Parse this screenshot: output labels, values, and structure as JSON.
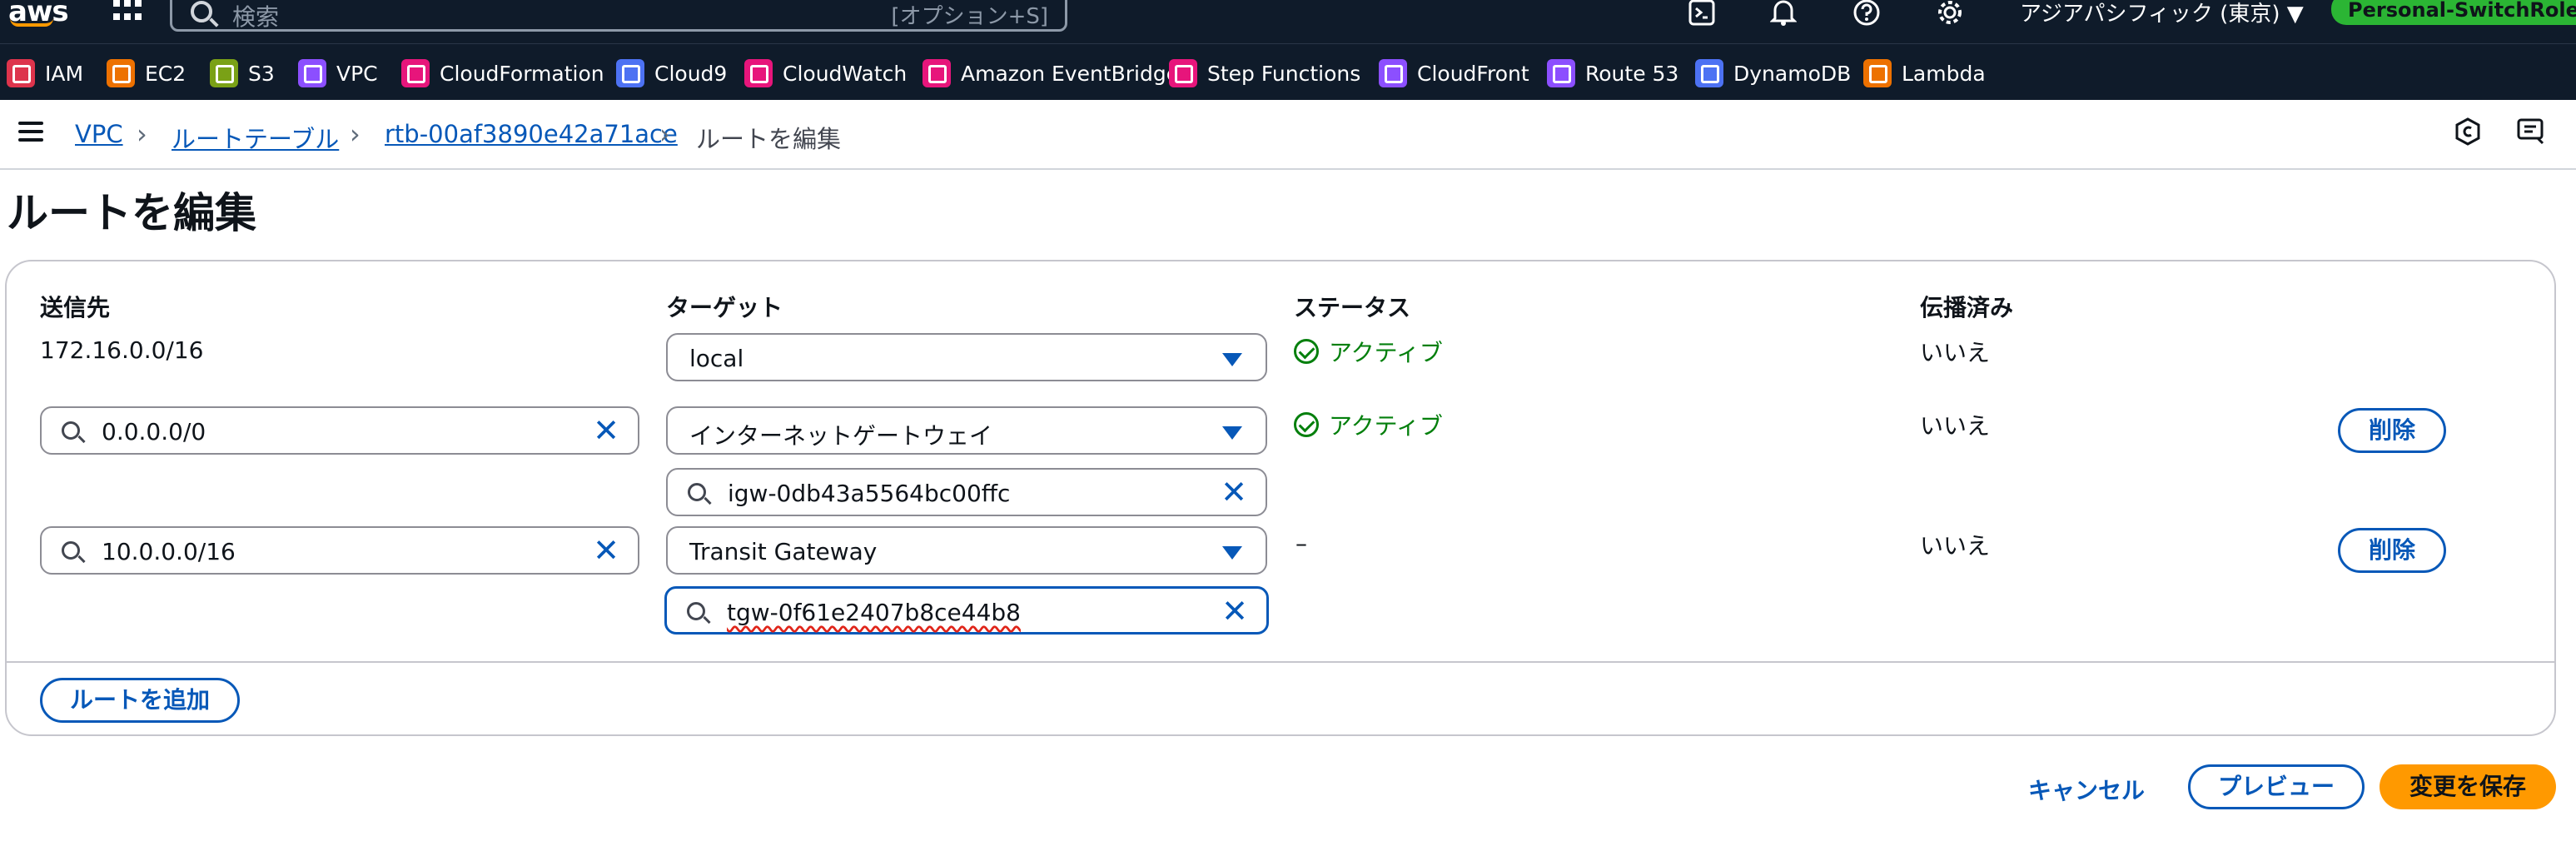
{
  "nav": {
    "logo": "aws",
    "search_placeholder": "検索",
    "search_shortcut": "[オプション+S]",
    "region": "アジアパシフィック (東京) ▼",
    "role": "Personal-SwitchRole ▼",
    "icons": [
      "services-grid-icon",
      "cloudshell-icon",
      "bell-icon",
      "help-icon",
      "gear-icon"
    ]
  },
  "favorites": [
    {
      "label": "IAM",
      "color": "#dd344c"
    },
    {
      "label": "EC2",
      "color": "#ed7100"
    },
    {
      "label": "S3",
      "color": "#7aa116"
    },
    {
      "label": "VPC",
      "color": "#8c4fff"
    },
    {
      "label": "CloudFormation",
      "color": "#e7157b"
    },
    {
      "label": "Cloud9",
      "color": "#4d72f3"
    },
    {
      "label": "CloudWatch",
      "color": "#e7157b"
    },
    {
      "label": "Amazon EventBridge",
      "color": "#e7157b"
    },
    {
      "label": "Step Functions",
      "color": "#e7157b"
    },
    {
      "label": "CloudFront",
      "color": "#8c4fff"
    },
    {
      "label": "Route 53",
      "color": "#8c4fff"
    },
    {
      "label": "DynamoDB",
      "color": "#4d72f3"
    },
    {
      "label": "Lambda",
      "color": "#ed7100"
    }
  ],
  "breadcrumb": {
    "items": [
      "VPC",
      "ルートテーブル",
      "rtb-00af3890e42a71ace"
    ],
    "current": "ルートを編集"
  },
  "page": {
    "title": "ルートを編集"
  },
  "table": {
    "columns": {
      "destination": "送信先",
      "target": "ターゲット",
      "status": "ステータス",
      "propagated": "伝播済み"
    },
    "rows": [
      {
        "destination": "172.16.0.0/16",
        "target": "local",
        "target_id": "",
        "status": "アクティブ",
        "propagated": "いいえ",
        "delete": ""
      },
      {
        "destination": "0.0.0.0/0",
        "target": "インターネットゲートウェイ",
        "target_id": "igw-0db43a5564bc00ffc",
        "status": "アクティブ",
        "propagated": "いいえ",
        "delete": "削除"
      },
      {
        "destination": "10.0.0.0/16",
        "target": "Transit Gateway",
        "target_id": "tgw-0f61e2407b8ce44b8",
        "status": "–",
        "propagated": "いいえ",
        "delete": "削除"
      }
    ]
  },
  "actions": {
    "add_route": "ルートを追加",
    "cancel": "キャンセル",
    "preview": "プレビュー",
    "save": "変更を保存"
  },
  "colors": {
    "accent": "#0758b8",
    "primary": "#ff9900",
    "success": "#037f0c",
    "nav_bg": "#0f1b2a"
  }
}
